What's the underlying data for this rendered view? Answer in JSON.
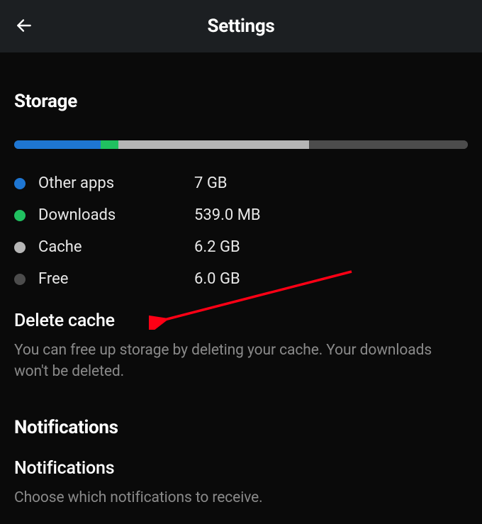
{
  "header": {
    "title": "Settings"
  },
  "storage": {
    "heading": "Storage",
    "segments": [
      {
        "color": "#1e76d2",
        "pct": 19
      },
      {
        "color": "#20c060",
        "pct": 4
      },
      {
        "color": "#b6b6b6",
        "pct": 42
      },
      {
        "color": "#4c4c4c",
        "pct": 35
      }
    ],
    "rows": [
      {
        "color": "#1e76d2",
        "label": "Other apps",
        "value": "7 GB"
      },
      {
        "color": "#20c060",
        "label": "Downloads",
        "value": "539.0 MB"
      },
      {
        "color": "#b6b6b6",
        "label": "Cache",
        "value": "6.2 GB"
      },
      {
        "color": "#4c4c4c",
        "label": "Free",
        "value": "6.0 GB"
      }
    ],
    "delete_cache": {
      "title": "Delete cache",
      "subtitle": "You can free up storage by deleting your cache. Your downloads won't be deleted."
    }
  },
  "notifications": {
    "heading": "Notifications",
    "item": {
      "title": "Notifications",
      "subtitle": "Choose which notifications to receive."
    }
  },
  "annotation": {
    "arrow_color": "#ff0015"
  }
}
